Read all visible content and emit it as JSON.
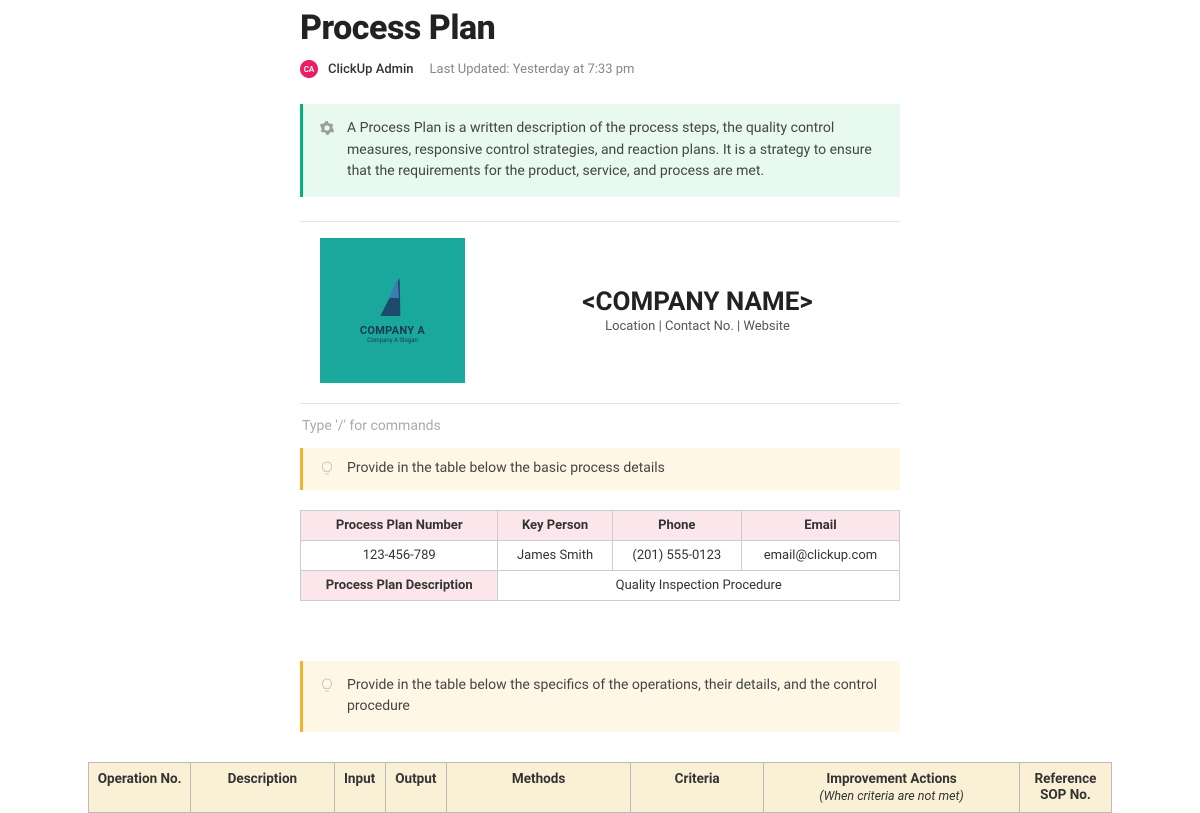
{
  "title": "Process Plan",
  "meta": {
    "avatar_initials": "CA",
    "author": "ClickUp Admin",
    "last_updated": "Last Updated: Yesterday at 7:33 pm"
  },
  "callout_intro": "A Process Plan is a written description of the process steps, the quality control measures, responsive control strategies, and reaction plans. It is a strategy to ensure that the requirements for the product, service, and process are met.",
  "company": {
    "logo_name": "COMPANY A",
    "logo_tagline": "Company A Slogan",
    "name_placeholder": "<COMPANY NAME>",
    "sub_placeholder": "Location | Contact No. | Website"
  },
  "command_hint": "Type '/' for commands",
  "callout_details": "Provide in the table below the basic process details",
  "details_table": {
    "headers": {
      "plan_number": "Process Plan Number",
      "key_person": "Key Person",
      "phone": "Phone",
      "email": "Email",
      "description_label": "Process Plan Description"
    },
    "values": {
      "plan_number": "123-456-789",
      "key_person": "James Smith",
      "phone": "(201) 555-0123",
      "email": "email@clickup.com",
      "description": "Quality Inspection Procedure"
    }
  },
  "callout_ops": "Provide in the table below the specifics of the operations, their details, and the control procedure",
  "ops_table": {
    "headers": {
      "operation_no": "Operation No.",
      "description": "Description",
      "input": "Input",
      "output": "Output",
      "methods": "Methods",
      "criteria": "Criteria",
      "improvement": "Improvement Actions",
      "improvement_sub": "(When criteria are not met)",
      "reference": "Reference SOP No."
    }
  }
}
